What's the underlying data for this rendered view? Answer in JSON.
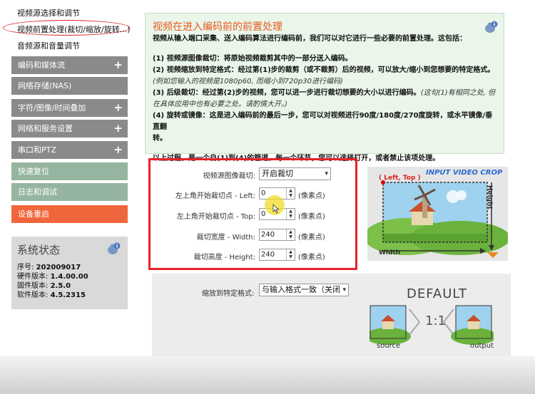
{
  "nav": {
    "links": [
      "视频源选择和调节",
      "视频前置处理(裁切/缩放/旋转...)",
      "音频源和音量调节"
    ],
    "menus": [
      {
        "label": "编码和媒体流",
        "plus": "+"
      },
      {
        "label": "网络存储(NAS)",
        "plus": ""
      },
      {
        "label": "字符/图像/时间叠加",
        "plus": "+"
      },
      {
        "label": "网络和服务设置",
        "plus": "+"
      },
      {
        "label": "串口和PTZ",
        "plus": "+"
      },
      {
        "label": "快速复位",
        "plus": ""
      },
      {
        "label": "日志和调试",
        "plus": ""
      },
      {
        "label": "设备重启",
        "plus": ""
      }
    ]
  },
  "status": {
    "title": "系统状态",
    "rows": [
      {
        "label": "序号: ",
        "value": "202009017"
      },
      {
        "label": "硬件版本: ",
        "value": "1.4.00.00"
      },
      {
        "label": "固件版本: ",
        "value": "2.5.0"
      },
      {
        "label": "软件版本: ",
        "value": "4.5.2315"
      }
    ]
  },
  "info": {
    "title": "视频在进入编码前的前置处理",
    "intro": "视频从输入端口采集、送入编码算法进行编码前，我们可以对它进行一些必要的前置处理。这包括：",
    "item1": "(1) 视频源图像裁切：将原始视频裁剪其中的一部分送入编码。",
    "item2": "(2) 视频缩放到特定格式：经过第(1)步的裁剪（或不裁剪）后的视频，可以放大/缩小到您想要的特定格式。",
    "item2_note1": "(例如您输入的视频是1080p60, 而缩小到720p30进行编码)",
    "item3": "(3) 后级裁切：经过第(2)步的视频，您可以进一步进行裁切想要的大小以进行编码。",
    "item3_note1": "(这句(1)有相同之处, 但在具体应用中也有必要之处。请酌情大开。)",
    "item4a": "(4) 旋转或镜像：这是进入编码前的最后一步，您可以对视频进行90度/180度/270度旋转，或水平镜像/垂直翻",
    "item4b": "转。",
    "summary": "以上过程，是一个自(1)到(4)的管道。每一个环节，您可以选择打开，或者禁止该项处理。"
  },
  "crop_form": {
    "crop_label": "视频源图像裁切:",
    "crop_value": "开启裁切",
    "left_label": "左上角开始裁切点 - Left:",
    "left_value": "0",
    "top_label": "左上角开始裁切点 - Top:",
    "top_value": "0",
    "width_label": "裁切宽度 - Width:",
    "width_value": "240",
    "height_label": "裁切高度 - Height:",
    "height_value": "240",
    "unit": "(像素点)"
  },
  "crop_figure": {
    "title": "INPUT VIDEO CROP",
    "corner": "( Left, Top )",
    "width": "Width",
    "height": "Height"
  },
  "scale_form": {
    "label": "缩放到特定格式:",
    "value": "与输入格式一致（关闭",
    "fig_title": "DEFAULT",
    "ratio": "1:1",
    "source": "source",
    "output": "output"
  }
}
